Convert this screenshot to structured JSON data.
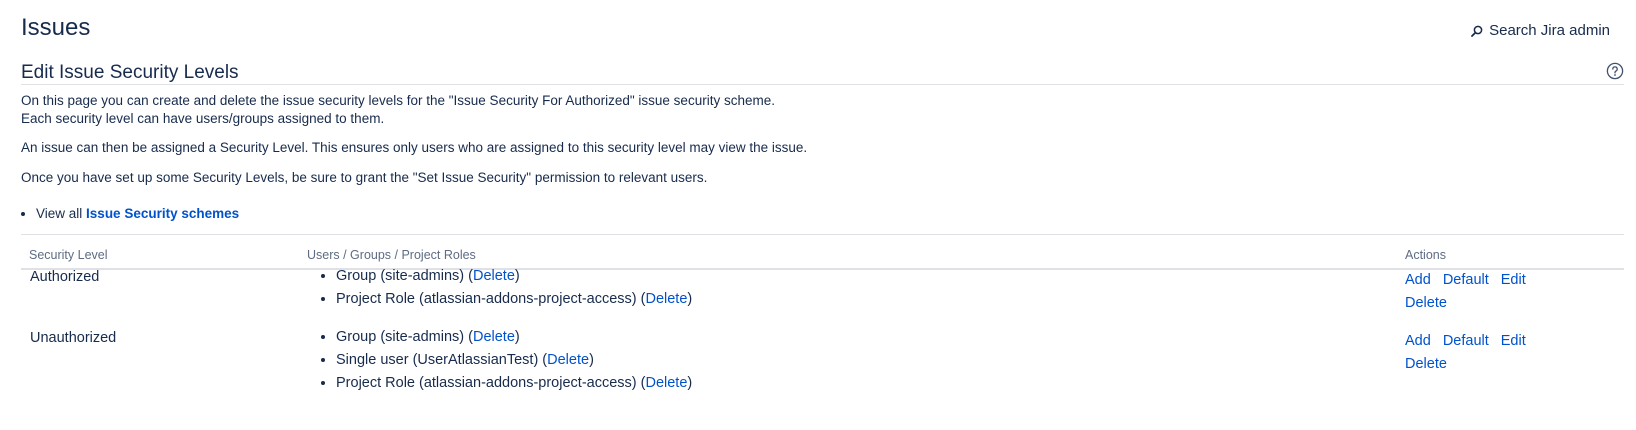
{
  "header": {
    "title": "Issues",
    "search_label": "Search Jira admin"
  },
  "section": {
    "title": "Edit Issue Security Levels"
  },
  "description": {
    "line1": "On this page you can create and delete the issue security levels for the \"Issue Security For Authorized\" issue security scheme.",
    "line2": "Each security level can have users/groups assigned to them.",
    "line3": "An issue can then be assigned a Security Level. This ensures only users who are assigned to this security level may view the issue.",
    "line4": "Once you have set up some Security Levels, be sure to grant the \"Set Issue Security\" permission to relevant users."
  },
  "links": {
    "view_all_prefix": "View all",
    "schemes_link": "Issue Security schemes"
  },
  "table": {
    "columns": [
      "Security Level",
      "Users / Groups / Project Roles",
      "Actions"
    ],
    "rows": [
      {
        "level": "Authorized",
        "entries": [
          {
            "text": "Group (site-admins)",
            "action": "Delete"
          },
          {
            "text": "Project Role (atlassian-addons-project-access)",
            "action": "Delete"
          }
        ],
        "actions": [
          "Add",
          "Default",
          "Edit",
          "Delete"
        ]
      },
      {
        "level": "Unauthorized",
        "entries": [
          {
            "text": "Group (site-admins)",
            "action": "Delete"
          },
          {
            "text": "Single user (UserAtlassianTest)",
            "action": "Delete"
          },
          {
            "text": "Project Role (atlassian-addons-project-access)",
            "action": "Delete"
          }
        ],
        "actions": [
          "Add",
          "Default",
          "Edit",
          "Delete"
        ]
      }
    ]
  }
}
